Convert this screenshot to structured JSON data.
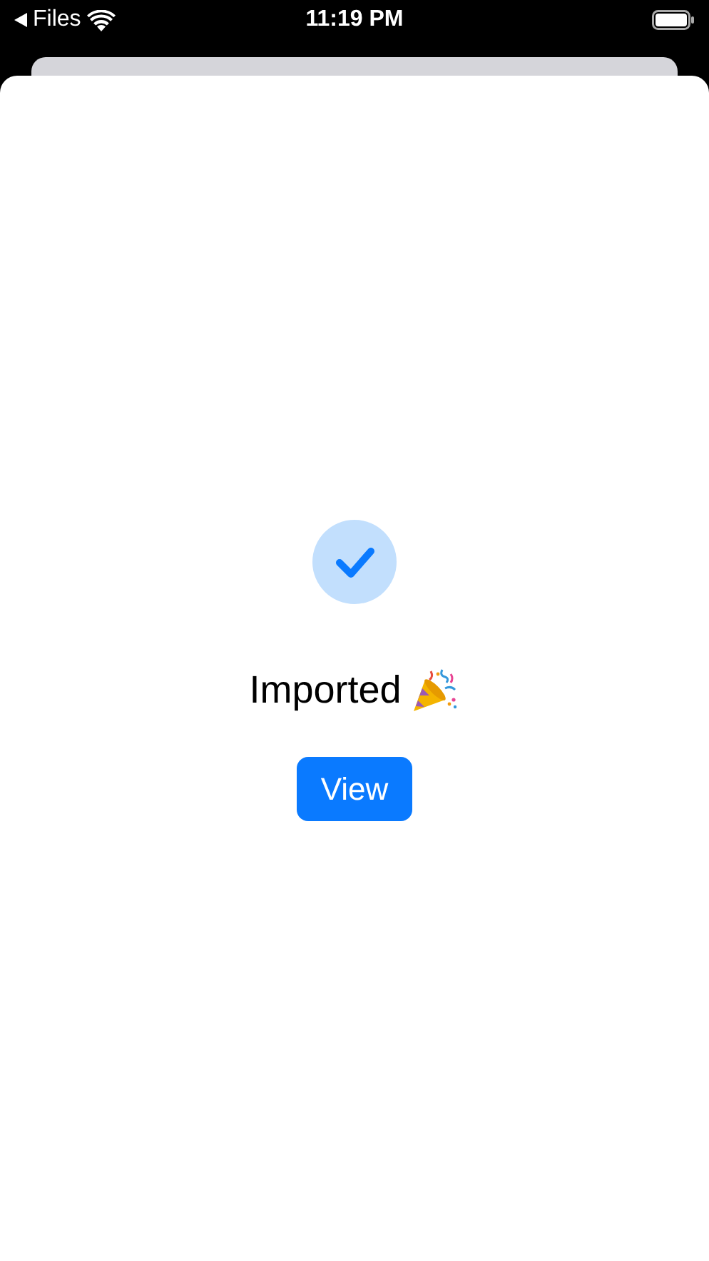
{
  "status_bar": {
    "back_label": "Files",
    "time": "11:19 PM"
  },
  "sheet": {
    "title": "Imported",
    "button": "View"
  }
}
